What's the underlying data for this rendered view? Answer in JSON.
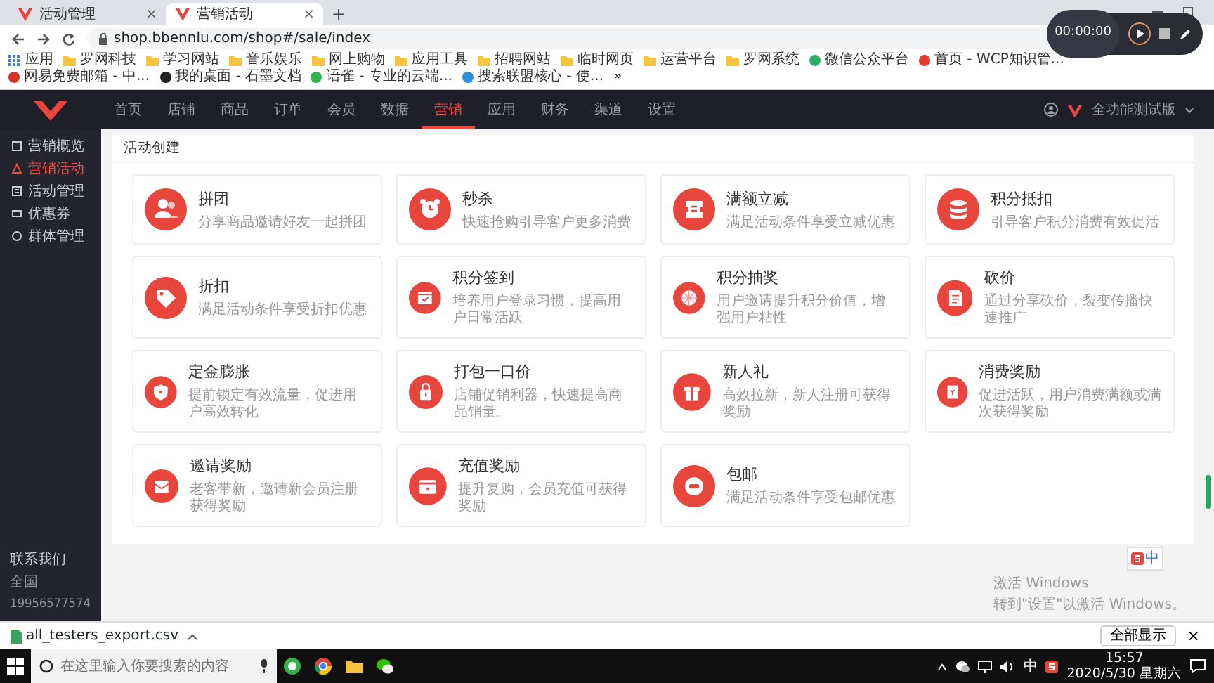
{
  "browser": {
    "tabs": [
      {
        "title": "活动管理",
        "close": "×",
        "selected": false
      },
      {
        "title": "营销活动",
        "close": "×",
        "selected": true
      }
    ],
    "new_tab": "+",
    "address": "shop.bbennlu.com/shop#/sale/index",
    "bookmarks": [
      {
        "label": "应用",
        "kind": "apps"
      },
      {
        "label": "罗网科技",
        "kind": "folder"
      },
      {
        "label": "学习网站",
        "kind": "folder"
      },
      {
        "label": "音乐娱乐",
        "kind": "folder"
      },
      {
        "label": "网上购物",
        "kind": "folder"
      },
      {
        "label": "应用工具",
        "kind": "folder"
      },
      {
        "label": "招聘网站",
        "kind": "folder"
      },
      {
        "label": "临时网页",
        "kind": "folder"
      },
      {
        "label": "运营平台",
        "kind": "folder"
      },
      {
        "label": "罗网系统",
        "kind": "folder"
      },
      {
        "label": "微信公众平台",
        "kind": "site",
        "color": "#2aae67"
      },
      {
        "label": "首页 - WCP知识管...",
        "kind": "site",
        "color": "#e03c31"
      },
      {
        "label": "网易免费邮箱 - 中...",
        "kind": "site",
        "color": "#d9342b"
      },
      {
        "label": "我的桌面 - 石墨文档",
        "kind": "site",
        "color": "#222222"
      },
      {
        "label": "语雀 - 专业的云端...",
        "kind": "site",
        "color": "#31b44b"
      },
      {
        "label": "搜索联盟核心 - 使...",
        "kind": "site",
        "color": "#2f8fd8"
      }
    ],
    "bookmarks_more": "»"
  },
  "recorder": {
    "time": "00:00:00"
  },
  "topnav": {
    "items": [
      {
        "label": "首页",
        "selected": false
      },
      {
        "label": "店铺",
        "selected": false
      },
      {
        "label": "商品",
        "selected": false
      },
      {
        "label": "订单",
        "selected": false
      },
      {
        "label": "会员",
        "selected": false
      },
      {
        "label": "数据",
        "selected": false
      },
      {
        "label": "营销",
        "selected": true
      },
      {
        "label": "应用",
        "selected": false
      },
      {
        "label": "财务",
        "selected": false
      },
      {
        "label": "渠道",
        "selected": false
      },
      {
        "label": "设置",
        "selected": false
      }
    ],
    "account": "全功能测试版"
  },
  "sidebar": {
    "items": [
      {
        "label": "营销概览",
        "selected": false
      },
      {
        "label": "营销活动",
        "selected": true
      },
      {
        "label": "活动管理",
        "selected": false
      },
      {
        "label": "优惠券",
        "selected": false
      },
      {
        "label": "群体管理",
        "selected": false
      }
    ],
    "contact_title": "联系我们",
    "region": "全国",
    "phone": "19956577574"
  },
  "panel": {
    "title": "活动创建",
    "cards": [
      {
        "title": "拼团",
        "description": "分享商品邀请好友一起拼团"
      },
      {
        "title": "秒杀",
        "description": "快速抢购引导客户更多消费"
      },
      {
        "title": "满额立减",
        "description": "满足活动条件享受立减优惠"
      },
      {
        "title": "积分抵扣",
        "description": "引导客户积分消费有效促活"
      },
      {
        "title": "折扣",
        "description": "满足活动条件享受折扣优惠"
      },
      {
        "title": "积分签到",
        "description": "培养用户登录习惯，提高用户日常活跃"
      },
      {
        "title": "积分抽奖",
        "description": "用户邀请提升积分价值，增强用户粘性"
      },
      {
        "title": "砍价",
        "description": "通过分享砍价，裂变传播快速推广"
      },
      {
        "title": "定金膨胀",
        "description": "提前锁定有效流量，促进用户高效转化"
      },
      {
        "title": "打包一口价",
        "description": "店铺促销利器，快速提高商品销量。"
      },
      {
        "title": "新人礼",
        "description": "高效拉新，新人注册可获得奖励"
      },
      {
        "title": "消费奖励",
        "description": "促进活跃，用户消费满额或满次获得奖励"
      },
      {
        "title": "邀请奖励",
        "description": "老客带新，邀请新会员注册获得奖励"
      },
      {
        "title": "充值奖励",
        "description": "提升复购，会员充值可获得奖励"
      },
      {
        "title": "包邮",
        "description": "满足活动条件享受包邮优惠"
      }
    ]
  },
  "ime": "中",
  "windows_notice": {
    "title": "激活 Windows",
    "text": "转到\"设置\"以激活 Windows。"
  },
  "download_bar": {
    "file": "all_testers_export.csv",
    "show_all": "全部显示",
    "close": "×"
  },
  "taskbar": {
    "search_placeholder": "在这里输入你要搜索的内容",
    "tray_lang": "中",
    "time": "15:57",
    "date": "2020/5/30 星期六"
  }
}
